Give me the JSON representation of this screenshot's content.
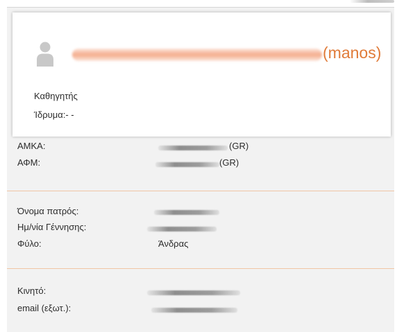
{
  "profile": {
    "username": "(manos)",
    "role": "Καθηγητής",
    "institution": "Ίδρυμα:- -"
  },
  "identifiers": {
    "amka_label": "ΑΜΚΑ:",
    "amka_suffix": "(GR)",
    "afm_label": "ΑΦΜ:",
    "afm_suffix": "(GR)"
  },
  "personal": {
    "father_name_label": "Όνομα πατρός:",
    "birth_date_label": "Ημ/νία Γέννησης:",
    "gender_label": "Φύλο:",
    "gender_value": "Άνδρας"
  },
  "contact": {
    "mobile_label": "Κινητό:",
    "email_label": "email (εξωτ.):"
  },
  "colors": {
    "accent": "#e07b39",
    "separator": "#f0c5a4",
    "panel_bg": "#f2f2f2",
    "card_bg": "#ffffff",
    "text": "#2c2c2c"
  },
  "icons": {
    "avatar": "user-silhouette-icon"
  }
}
